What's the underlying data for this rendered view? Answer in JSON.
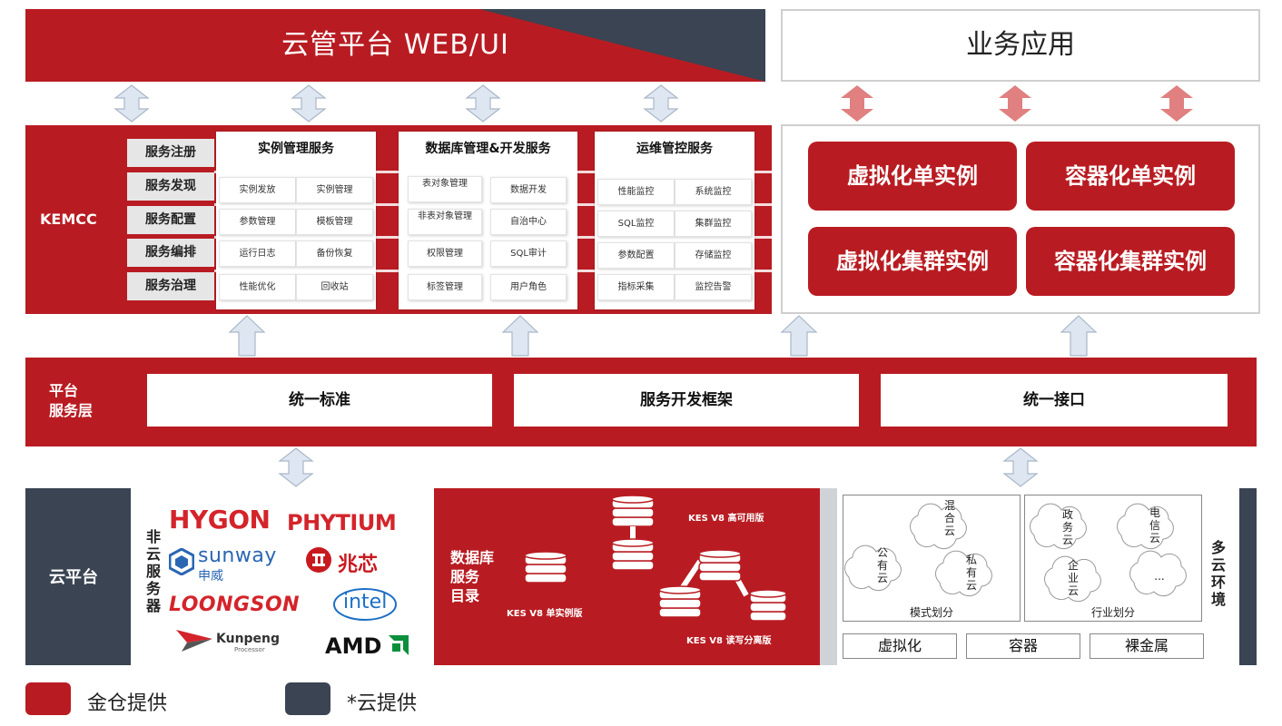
{
  "top": {
    "cloud_ui_title": "云管平台 WEB/UI",
    "business_title": "业务应用"
  },
  "kemcc": {
    "label": "KEMCC",
    "services": [
      "服务注册",
      "服务发现",
      "服务配置",
      "服务编排",
      "服务治理"
    ],
    "panels": [
      {
        "title": "实例管理服务",
        "cells": [
          [
            "实例发放",
            "实例管理"
          ],
          [
            "参数管理",
            "模板管理"
          ],
          [
            "运行日志",
            "备份恢复"
          ],
          [
            "性能优化",
            "回收站"
          ]
        ]
      },
      {
        "title": "数据库管理&开发服务",
        "cells": [
          [
            "表对象管理",
            "数据开发"
          ],
          [
            "非表对象管理",
            "自治中心"
          ],
          [
            "权限管理",
            "SQL审计"
          ],
          [
            "标签管理",
            "用户角色"
          ]
        ]
      },
      {
        "title": "运维管控服务",
        "cells": [
          [
            "性能监控",
            "系统监控"
          ],
          [
            "SQL监控",
            "集群监控"
          ],
          [
            "参数配置",
            "存储监控"
          ],
          [
            "指标采集",
            "监控告警"
          ]
        ]
      }
    ]
  },
  "instances": {
    "virt_single": "虚拟化单实例",
    "container_single": "容器化单实例",
    "virt_cluster": "虚拟化集群实例",
    "container_cluster": "容器化集群实例"
  },
  "platform": {
    "label_line1": "平台",
    "label_line2": "服务层",
    "items": [
      "统一标准",
      "服务开发框架",
      "统一接口"
    ]
  },
  "cloud": {
    "label": "云平台",
    "non_cloud_servers": "非云服务器",
    "vendors": {
      "hygon": "HYGON",
      "phytium": "PHYTIUM",
      "sunway": "SUNWAY",
      "sunway_cn": "申威",
      "zhaoxin": "兆芯",
      "loongson": "LOONGSON",
      "intel": "intel",
      "kunpeng": "Kunpeng",
      "kunpeng_sub": "Processor",
      "amd": "AMD"
    },
    "db_catalog_line1": "数据库",
    "db_catalog_line2": "服务",
    "db_catalog_line3": "目录",
    "kes_single": "KES V8 单实例版",
    "kes_ha": "KES V8 高可用版",
    "kes_rw": "KES V8 读写分离版",
    "mode_box": {
      "clouds": [
        "混合云",
        "公有云",
        "私有云"
      ],
      "caption": "模式划分"
    },
    "industry_box": {
      "clouds": [
        "政务云",
        "电信云",
        "企业云",
        "..."
      ],
      "caption": "行业划分"
    },
    "capabilities": [
      "虚拟化",
      "容器",
      "裸金属"
    ],
    "multi_cloud": "多云环境"
  },
  "legend": {
    "jincang": "金仓提供",
    "cloud_provided": "*云提供"
  },
  "colors": {
    "brand_red": "#b81c22",
    "dark_slate": "#3a4452",
    "arrow_blue": "#dde6f1",
    "arrow_pink": "#e08080"
  }
}
